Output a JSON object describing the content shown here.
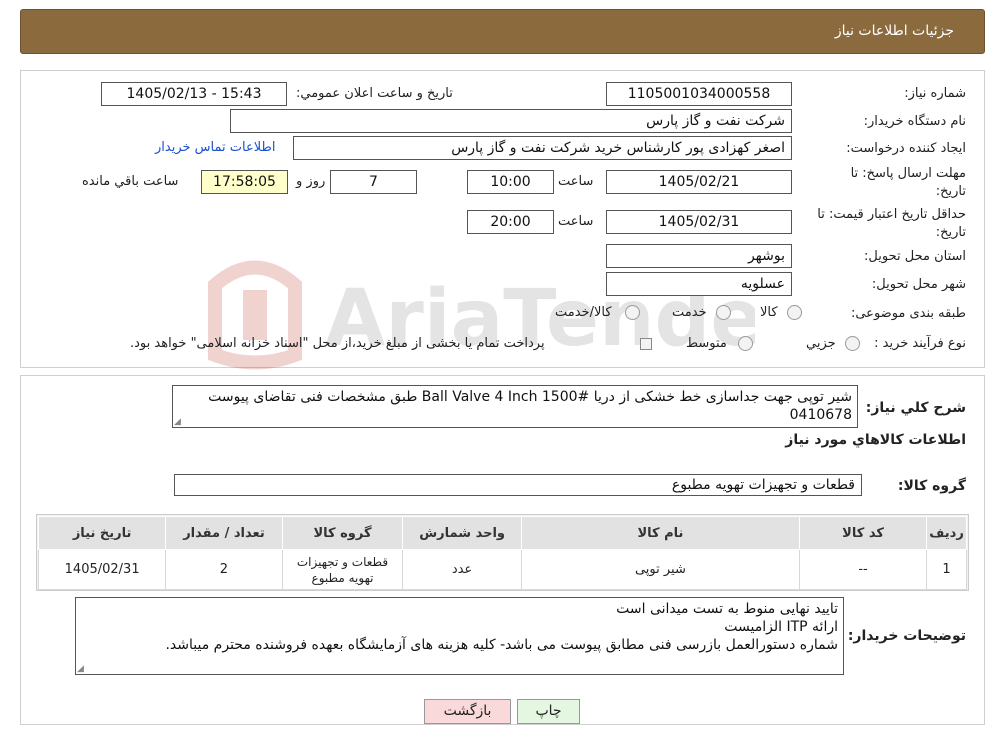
{
  "header": {
    "title": "جزئیات اطلاعات نیاز"
  },
  "form": {
    "need_number_label": "شماره نیاز:",
    "need_number": "1105001034000558",
    "announce_label": "تاریخ و ساعت اعلان عمومي:",
    "announce_value": "1405/02/13 - 15:43",
    "buyer_org_label": "نام دستگاه خریدار:",
    "buyer_org": "شرکت نفت و گاز پارس",
    "requester_label": "ایجاد کننده درخواست:",
    "requester": "اصغر کهزادی پور کارشناس خرید شرکت نفت و گاز پارس",
    "contact_link": "اطلاعات تماس خریدار",
    "deadline_label_1": "مهلت ارسال پاسخ: تا",
    "deadline_label_2": "تاریخ:",
    "deadline_date": "1405/02/21",
    "time_label": "ساعت",
    "deadline_time": "10:00",
    "days_value": "7",
    "days_label": "روز و",
    "remaining_time": "17:58:05",
    "remaining_label": "ساعت باقي مانده",
    "validity_label_1": "حداقل تاریخ اعتبار قیمت: تا",
    "validity_label_2": "تاریخ:",
    "validity_date": "1405/02/31",
    "validity_time": "20:00",
    "province_label": "استان محل تحویل:",
    "province": "بوشهر",
    "city_label": "شهر محل تحویل:",
    "city": "عسلویه",
    "category_label": "طبقه بندی موضوعی:",
    "category_options": [
      "کالا",
      "خدمت",
      "کالا/خدمت"
    ],
    "purchase_type_label": "نوع فرآیند خرید :",
    "purchase_options": [
      "جزيي",
      "متوسط"
    ],
    "purchase_note": "پرداخت تمام یا بخشی از مبلغ خرید،از محل \"اسناد خزانه اسلامی\" خواهد بود."
  },
  "description": {
    "label": "شرح کلي نیاز:",
    "text": "شیر توپی جهت جداسازی خط خشکی از دریا Ball Valve 4 Inch 1500# طبق مشخصات فنی تقاضای پیوست 0410678"
  },
  "goods": {
    "section_title": "اطلاعات کالاهاي مورد نیاز",
    "group_label": "گروه کالا:",
    "group_value": "قطعات و تجهیزات تهویه مطبوع",
    "table": {
      "headers": [
        "ردیف",
        "کد کالا",
        "نام کالا",
        "واحد شمارش",
        "گروه کالا",
        "تعداد / مقدار",
        "تاریخ نیاز"
      ],
      "rows": [
        [
          "1",
          "--",
          "شیر توپی",
          "عدد",
          "قطعات و تجهیزات تهویه مطبوع",
          "2",
          "1405/02/31"
        ]
      ]
    }
  },
  "buyer_notes": {
    "label": "توضیحات خریدار:",
    "lines": [
      "تایید نهایی منوط به تست میدانی است",
      "ارائه ITP الزامیست",
      "شماره دستورالعمل بازرسی فنی مطابق پیوست می باشد- کلیه هزینه های آزمایشگاه بعهده فروشنده محترم میباشد."
    ]
  },
  "buttons": {
    "print": "چاپ",
    "back": "بازگشت"
  },
  "colors": {
    "header_bg": "#8B6A3E",
    "yellow_field": "#FFFFCC",
    "link": "#1a4fd1",
    "back_btn": "#F9D9D9",
    "print_btn": "#E4F7E0"
  }
}
